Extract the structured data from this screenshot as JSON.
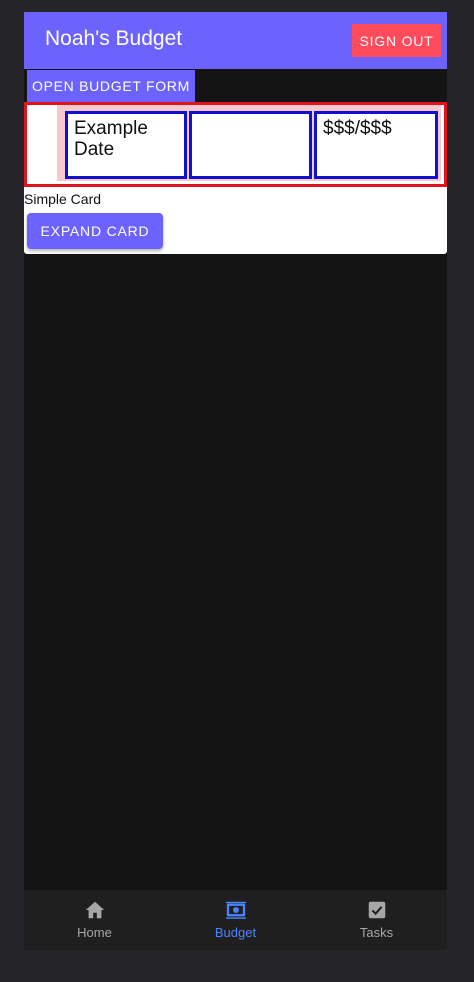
{
  "app": {
    "title": "Noah's Budget",
    "sign_out_label": "SIGN OUT"
  },
  "actions": {
    "open_form_label": "OPEN BUDGET FORM"
  },
  "card": {
    "row": {
      "date": "Example Date",
      "middle": "",
      "amount": "$$$/$$$"
    },
    "label": "Simple Card",
    "expand_label": "EXPAND CARD"
  },
  "nav": {
    "items": [
      {
        "label": "Home",
        "icon": "home-icon",
        "active": false
      },
      {
        "label": "Budget",
        "icon": "money-icon",
        "active": true
      },
      {
        "label": "Tasks",
        "icon": "checkbox-icon",
        "active": false
      }
    ]
  },
  "colors": {
    "accent": "#6c63ff",
    "danger": "#ff4b5c",
    "active_nav": "#4a84ff",
    "table_outline": "#e0141e",
    "cell_border": "#1010d0"
  }
}
